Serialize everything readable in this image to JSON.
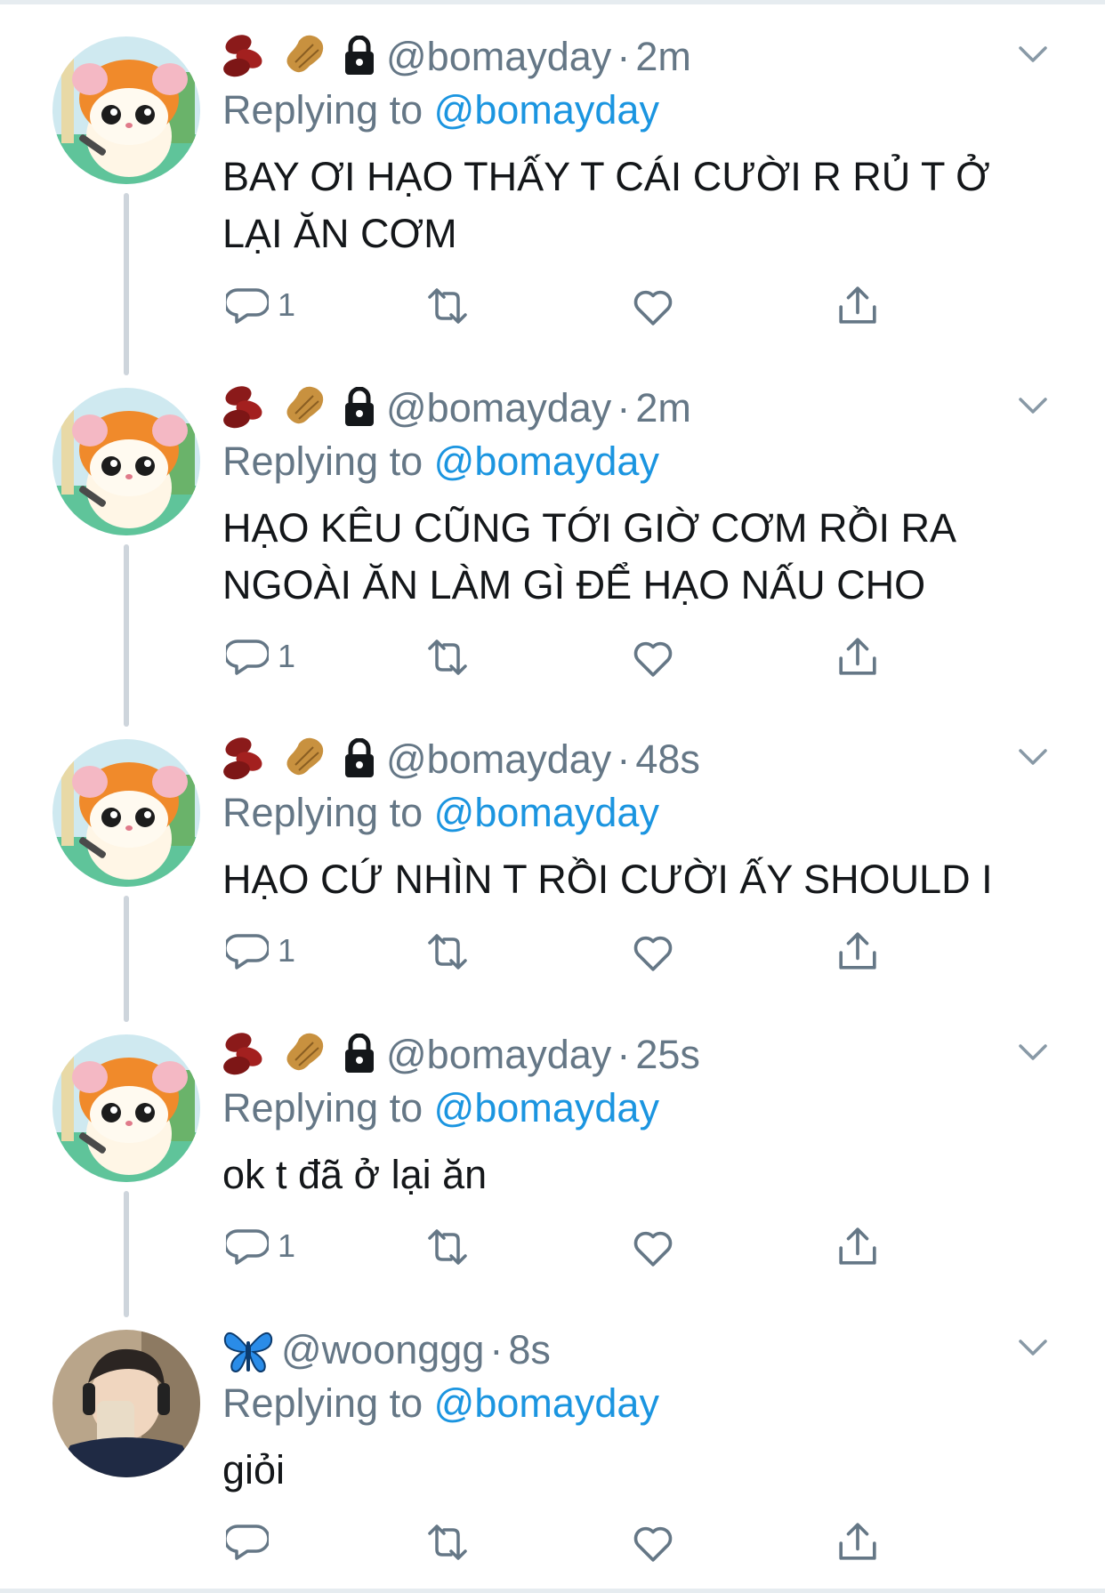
{
  "thread": [
    {
      "handle": "@bomayday",
      "separator": "·",
      "time": "2m",
      "reply_prefix": "Replying to",
      "reply_to": "@bomayday",
      "text": "BAY ƠI HẠO THẤY T CÁI CƯỜI R RỦ T Ở LẠI ĂN CƠM",
      "reply_count": "1",
      "avatar": "hamster-avatar",
      "emojis": [
        "beans-emoji",
        "peanut-emoji",
        "lock-icon"
      ]
    },
    {
      "handle": "@bomayday",
      "separator": "·",
      "time": "2m",
      "reply_prefix": "Replying to",
      "reply_to": "@bomayday",
      "text": "HẠO KÊU CŨNG TỚI GIỜ CƠM RỒI RA NGOÀI ĂN LÀM GÌ ĐỂ HẠO NẤU CHO",
      "reply_count": "1",
      "avatar": "hamster-avatar",
      "emojis": [
        "beans-emoji",
        "peanut-emoji",
        "lock-icon"
      ]
    },
    {
      "handle": "@bomayday",
      "separator": "·",
      "time": "48s",
      "reply_prefix": "Replying to",
      "reply_to": "@bomayday",
      "text": "HẠO CỨ NHÌN T RỒI CƯỜI ẤY SHOULD I",
      "reply_count": "1",
      "avatar": "hamster-avatar",
      "emojis": [
        "beans-emoji",
        "peanut-emoji",
        "lock-icon"
      ]
    },
    {
      "handle": "@bomayday",
      "separator": "·",
      "time": "25s",
      "reply_prefix": "Replying to",
      "reply_to": "@bomayday",
      "text": "ok t đã ở lại ăn",
      "reply_count": "1",
      "avatar": "hamster-avatar",
      "emojis": [
        "beans-emoji",
        "peanut-emoji",
        "lock-icon"
      ]
    },
    {
      "handle": "@woonggg",
      "separator": "·",
      "time": "8s",
      "reply_prefix": "Replying to",
      "reply_to": "@bomayday",
      "text": "giỏi",
      "reply_count": "",
      "avatar": "person-photo-avatar",
      "emojis": [
        "butterfly-emoji"
      ]
    }
  ],
  "colors": {
    "secondary_text": "#657786",
    "link": "#1b95e0",
    "primary_text": "#14171a",
    "thread_line": "#ced5dc"
  }
}
